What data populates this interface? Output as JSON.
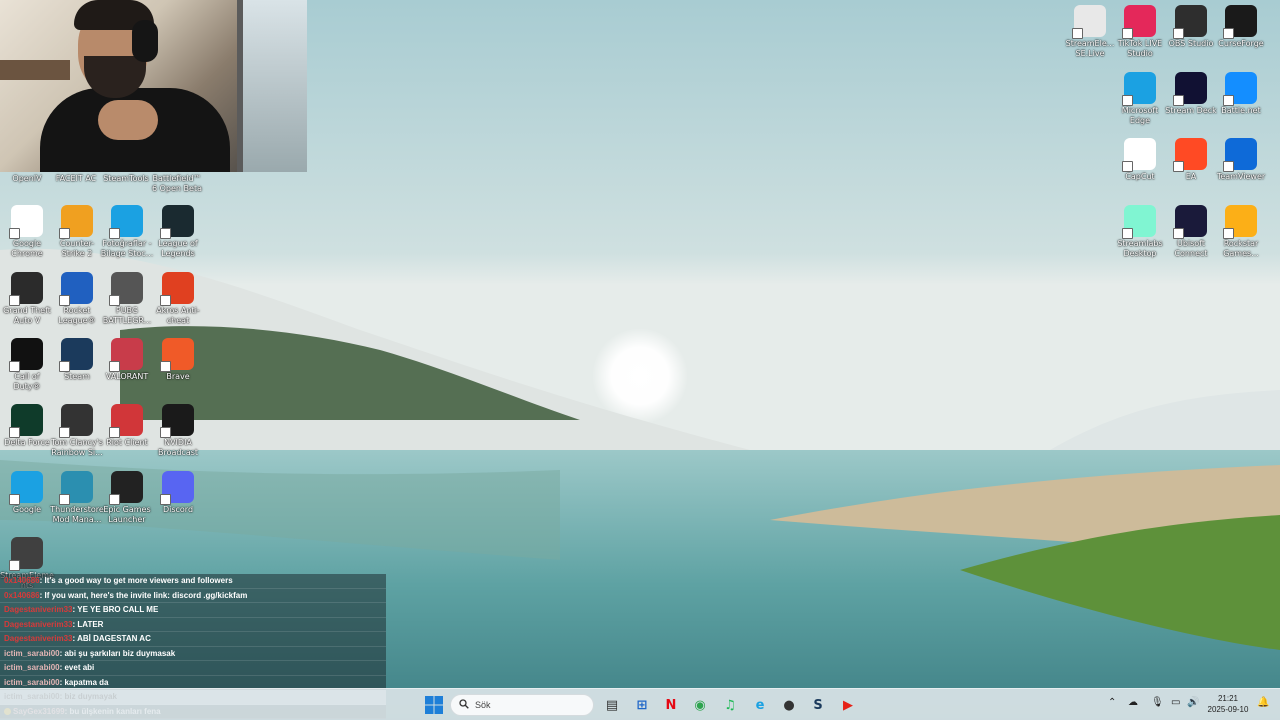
{
  "webcam": {
    "labels_below": [
      "OpenIV",
      "FACEIT AC",
      "SteamTools",
      "Battlefield™ 6 Open Beta"
    ]
  },
  "desktop_left": [
    {
      "label": "Google Chrome",
      "icon": "chrome-icon",
      "color": "#ffffff"
    },
    {
      "label": "Counter-Strike 2",
      "icon": "counter-strike-icon",
      "color": "#f0a020"
    },
    {
      "label": "Fotoğraflar - Bilage Stoc...",
      "icon": "edge-icon",
      "color": "#1ba1e2"
    },
    {
      "label": "League of Legends",
      "icon": "league-icon",
      "color": "#1a2a30"
    },
    {
      "label": "Grand Theft Auto V",
      "icon": "gta-icon",
      "color": "#2b2b2b"
    },
    {
      "label": "Rocket League®",
      "icon": "rocket-league-icon",
      "color": "#2060c0"
    },
    {
      "label": "PUBG BATTLEGR...",
      "icon": "pubg-icon",
      "color": "#555555"
    },
    {
      "label": "Akros Anti-cheat",
      "icon": "akros-icon",
      "color": "#e04020"
    },
    {
      "label": "Call of Duty®",
      "icon": "call-of-duty-icon",
      "color": "#111111"
    },
    {
      "label": "Steam",
      "icon": "steam-icon",
      "color": "#1b3a5c"
    },
    {
      "label": "VALORANT",
      "icon": "valorant-icon",
      "color": "#c83c4a"
    },
    {
      "label": "Brave",
      "icon": "brave-icon",
      "color": "#f05a28"
    },
    {
      "label": "Delta Force",
      "icon": "delta-force-icon",
      "color": "#0f3b2a"
    },
    {
      "label": "Tom Clancy's Rainbow Si...",
      "icon": "rainbow-six-icon",
      "color": "#333333"
    },
    {
      "label": "Riot Client",
      "icon": "riot-client-icon",
      "color": "#d13639"
    },
    {
      "label": "NVIDIA Broadcast",
      "icon": "nvidia-icon",
      "color": "#1a1a1a"
    },
    {
      "label": "Google",
      "icon": "edge-icon",
      "color": "#1ba1e2"
    },
    {
      "label": "Thunderstore Mod Mana...",
      "icon": "thunderstore-icon",
      "color": "#2b8fb0"
    },
    {
      "label": "Epic Games Launcher",
      "icon": "epic-games-icon",
      "color": "#222222"
    },
    {
      "label": "Discord",
      "icon": "discord-icon",
      "color": "#5865f2"
    },
    {
      "label": "StreamElements",
      "icon": "stream-elements-icon",
      "color": "#404040"
    }
  ],
  "desktop_right": [
    {
      "label": "StreamEle... SE.Live",
      "icon": "streamelements-icon",
      "color": "#e8e8e8"
    },
    {
      "label": "TikTok LIVE Studio",
      "icon": "tiktok-icon",
      "color": "#e4285a"
    },
    {
      "label": "OBS Studio",
      "icon": "obs-icon",
      "color": "#2e2e2e"
    },
    {
      "label": "CurseForge",
      "icon": "curseforge-icon",
      "color": "#1a1a1a"
    },
    {
      "label": "Microsoft Edge",
      "icon": "edge-icon",
      "color": "#1ba1e2"
    },
    {
      "label": "Stream Deck",
      "icon": "stream-deck-icon",
      "color": "#111133"
    },
    {
      "label": "Battle.net",
      "icon": "battlenet-icon",
      "color": "#148eff"
    },
    {
      "label": "CapCut",
      "icon": "capcut-icon",
      "color": "#ffffff"
    },
    {
      "label": "EA",
      "icon": "ea-icon",
      "color": "#ff4a24"
    },
    {
      "label": "TeamViewer",
      "icon": "teamviewer-icon",
      "color": "#0e6ad8"
    },
    {
      "label": "Streamlabs Desktop",
      "icon": "streamlabs-icon",
      "color": "#80f5d2"
    },
    {
      "label": "Ubisoft Connect",
      "icon": "ubisoft-icon",
      "color": "#1a1a3a"
    },
    {
      "label": "Rockstar Games...",
      "icon": "rockstar-icon",
      "color": "#fcaf17"
    }
  ],
  "chat": [
    {
      "user": "0x140686",
      "text": ": It's a good way to get more viewers and followers",
      "style": "dark",
      "user_color": "red"
    },
    {
      "user": "0x140686",
      "text": ": If you want, here's the invite link: discord .gg/kickfam",
      "style": "dark",
      "user_color": "red"
    },
    {
      "user": "Dagestaniverim33",
      "text": ": YE YE BRO CALL ME",
      "style": "dark",
      "user_color": "red"
    },
    {
      "user": "Dagestaniverim33",
      "text": ": LATER",
      "style": "dark",
      "user_color": "red"
    },
    {
      "user": "Dagestaniverim33",
      "text": ": ABİ DAGESTAN AC",
      "style": "dark",
      "user_color": "red"
    },
    {
      "user": "ictim_sarabi00",
      "text": ": abi şu şarkıları biz duymasak",
      "style": "dark",
      "user_color": "pink"
    },
    {
      "user": "ictim_sarabi00",
      "text": ": evet abi",
      "style": "dark",
      "user_color": "pink"
    },
    {
      "user": "ictim_sarabi00",
      "text": ": kapatma da",
      "style": "dark",
      "user_color": "pink"
    },
    {
      "user": "ictim_sarabi00",
      "text": ": biz duymayak",
      "style": "light",
      "user_color": "pink"
    },
    {
      "user": "SayGex31699",
      "text": ": bu ülşkenin kanları fena",
      "style": "dark",
      "user_color": "pink"
    }
  ],
  "taskbar": {
    "search_placeholder": "Sök",
    "time": "21:21",
    "date": "2025-09-10",
    "apps": [
      {
        "name": "file-explorer",
        "glyph": "▤",
        "color": "#333"
      },
      {
        "name": "microsoft-store",
        "glyph": "⊞",
        "color": "#1e66c8"
      },
      {
        "name": "netflix",
        "glyph": "N",
        "color": "#e50914"
      },
      {
        "name": "chrome",
        "glyph": "◉",
        "color": "#2ea44f"
      },
      {
        "name": "spotify",
        "glyph": "♫",
        "color": "#1db954"
      },
      {
        "name": "edge",
        "glyph": "e",
        "color": "#1ba1e2"
      },
      {
        "name": "obs",
        "glyph": "●",
        "color": "#333"
      },
      {
        "name": "steam",
        "glyph": "S",
        "color": "#1b3a5c"
      },
      {
        "name": "youtube",
        "glyph": "▶",
        "color": "#e62117"
      }
    ]
  },
  "colors": {
    "sky_top": "#a9cdd3",
    "sky_bottom": "#dbe7e6",
    "water": "#5fa3a3",
    "grass": "#6b9a3a"
  }
}
